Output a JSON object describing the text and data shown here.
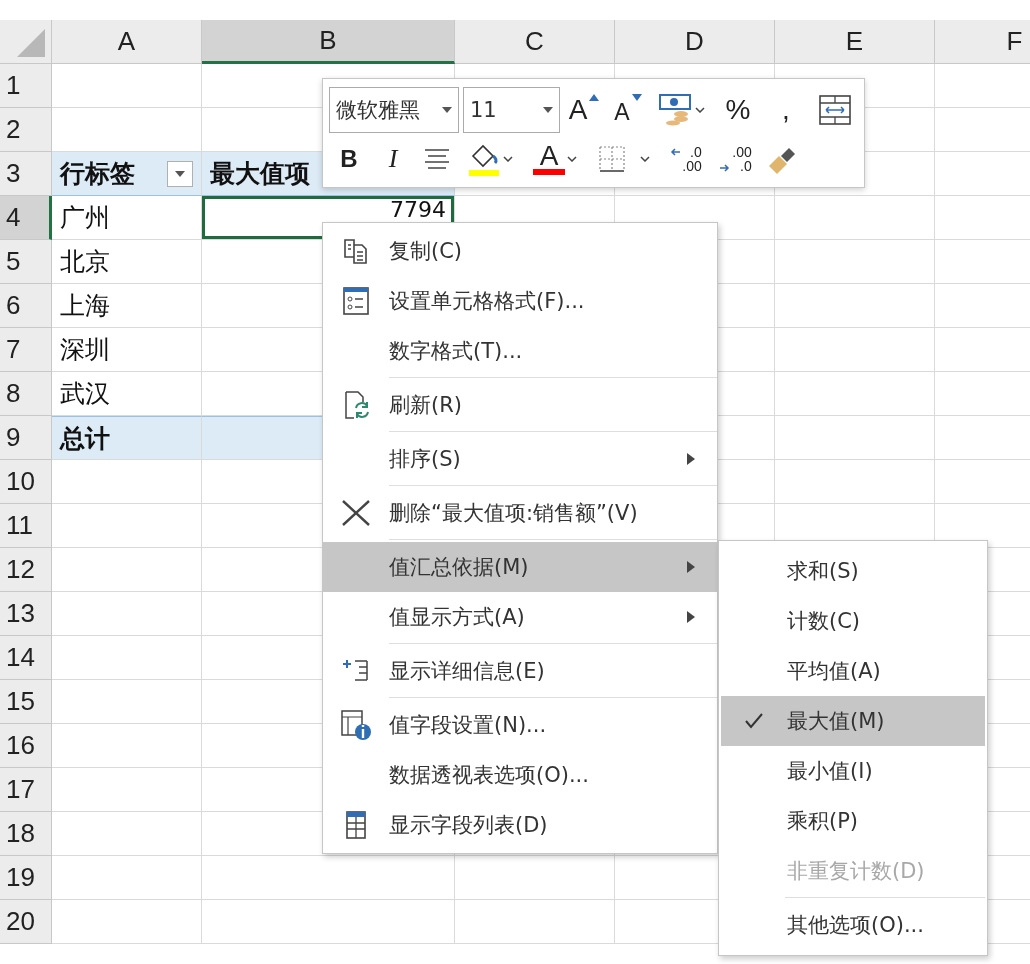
{
  "sheet": {
    "columns": [
      {
        "label": "A",
        "selected": false
      },
      {
        "label": "B",
        "selected": true
      },
      {
        "label": "C",
        "selected": false
      },
      {
        "label": "D",
        "selected": false
      },
      {
        "label": "E",
        "selected": false
      },
      {
        "label": "F",
        "selected": false
      }
    ],
    "rows": [
      {
        "label": "1",
        "selected": false,
        "kind": "plain",
        "cells": []
      },
      {
        "label": "2",
        "selected": false,
        "kind": "plain",
        "cells": []
      },
      {
        "label": "3",
        "selected": false,
        "kind": "pivot_header",
        "cells": [
          {
            "text": "行标签",
            "kind": "filter"
          },
          {
            "text": "最大值项",
            "kind": "label"
          }
        ]
      },
      {
        "label": "4",
        "selected": true,
        "kind": "pivot_row",
        "cells": [
          {
            "text": "广州",
            "kind": "label"
          },
          {
            "text": "7794",
            "kind": "value"
          }
        ]
      },
      {
        "label": "5",
        "selected": false,
        "kind": "pivot_row",
        "cells": [
          {
            "text": "北京",
            "kind": "label"
          }
        ]
      },
      {
        "label": "6",
        "selected": false,
        "kind": "pivot_row",
        "cells": [
          {
            "text": "上海",
            "kind": "label"
          }
        ]
      },
      {
        "label": "7",
        "selected": false,
        "kind": "pivot_row",
        "cells": [
          {
            "text": "深圳",
            "kind": "label"
          }
        ]
      },
      {
        "label": "8",
        "selected": false,
        "kind": "pivot_row",
        "cells": [
          {
            "text": "武汉",
            "kind": "label"
          }
        ]
      },
      {
        "label": "9",
        "selected": false,
        "kind": "pivot_total",
        "cells": [
          {
            "text": "总计",
            "kind": "label"
          }
        ]
      },
      {
        "label": "10",
        "selected": false,
        "kind": "plain",
        "cells": []
      },
      {
        "label": "11",
        "selected": false,
        "kind": "plain",
        "cells": []
      },
      {
        "label": "12",
        "selected": false,
        "kind": "plain",
        "cells": []
      },
      {
        "label": "13",
        "selected": false,
        "kind": "plain",
        "cells": []
      },
      {
        "label": "14",
        "selected": false,
        "kind": "plain",
        "cells": []
      },
      {
        "label": "15",
        "selected": false,
        "kind": "plain",
        "cells": []
      },
      {
        "label": "16",
        "selected": false,
        "kind": "plain",
        "cells": []
      },
      {
        "label": "17",
        "selected": false,
        "kind": "plain",
        "cells": []
      },
      {
        "label": "18",
        "selected": false,
        "kind": "plain",
        "cells": []
      },
      {
        "label": "19",
        "selected": false,
        "kind": "plain",
        "cells": []
      },
      {
        "label": "20",
        "selected": false,
        "kind": "plain",
        "cells": []
      }
    ]
  },
  "mini_toolbar": {
    "font": "微软雅黑",
    "size": "11",
    "row_1": [
      {
        "kind": "grow",
        "label": "A"
      },
      {
        "kind": "shrink",
        "label": "A"
      },
      {
        "kind": "currency"
      },
      {
        "kind": "text",
        "label": "%"
      },
      {
        "kind": "text",
        "label": ","
      },
      {
        "kind": "wrap"
      }
    ],
    "row_2": [
      {
        "kind": "bold",
        "label": "B"
      },
      {
        "kind": "italic",
        "label": "I"
      },
      {
        "kind": "align"
      },
      {
        "kind": "fill",
        "color": "#ffff00"
      },
      {
        "kind": "fontcolor",
        "label": "A",
        "color": "#ff0000"
      },
      {
        "kind": "borders"
      },
      {
        "kind": "inc_decimal",
        "lines": [
          ".0",
          ".00"
        ]
      },
      {
        "kind": "dec_decimal",
        "lines": [
          ".00",
          ".0"
        ]
      },
      {
        "kind": "painter"
      }
    ]
  },
  "context_menu": {
    "groups": [
      [
        {
          "label": "复制(C)",
          "selected": false,
          "has_submenu": false
        },
        {
          "label": "设置单元格格式(F)...",
          "selected": false,
          "has_submenu": false
        },
        {
          "label": "数字格式(T)...",
          "selected": false,
          "has_submenu": false
        }
      ],
      [
        {
          "label": "刷新(R)",
          "selected": false,
          "has_submenu": false
        }
      ],
      [
        {
          "label": "排序(S)",
          "selected": false,
          "has_submenu": true
        }
      ],
      [
        {
          "label": "删除“最大值项:销售额”(V)",
          "selected": false,
          "has_submenu": false
        }
      ],
      [
        {
          "label": "值汇总依据(M)",
          "selected": true,
          "has_submenu": true
        },
        {
          "label": "值显示方式(A)",
          "selected": false,
          "has_submenu": true
        }
      ],
      [
        {
          "label": "显示详细信息(E)",
          "selected": false,
          "has_submenu": false
        }
      ],
      [
        {
          "label": "值字段设置(N)...",
          "selected": false,
          "has_submenu": false
        },
        {
          "label": "数据透视表选项(O)...",
          "selected": false,
          "has_submenu": false
        },
        {
          "label": "显示字段列表(D)",
          "selected": false,
          "has_submenu": false
        }
      ]
    ]
  },
  "submenu": {
    "groups": [
      [
        {
          "label": "求和(S)",
          "checked": false,
          "selected": false,
          "disabled": false
        },
        {
          "label": "计数(C)",
          "checked": false,
          "selected": false,
          "disabled": false
        },
        {
          "label": "平均值(A)",
          "checked": false,
          "selected": false,
          "disabled": false
        },
        {
          "label": "最大值(M)",
          "checked": true,
          "selected": true,
          "disabled": false
        },
        {
          "label": "最小值(I)",
          "checked": false,
          "selected": false,
          "disabled": false
        },
        {
          "label": "乘积(P)",
          "checked": false,
          "selected": false,
          "disabled": false
        },
        {
          "label": "非重复计数(D)",
          "checked": false,
          "selected": false,
          "disabled": true
        }
      ],
      [
        {
          "label": "其他选项(O)...",
          "checked": false,
          "selected": false,
          "disabled": false
        }
      ]
    ]
  }
}
